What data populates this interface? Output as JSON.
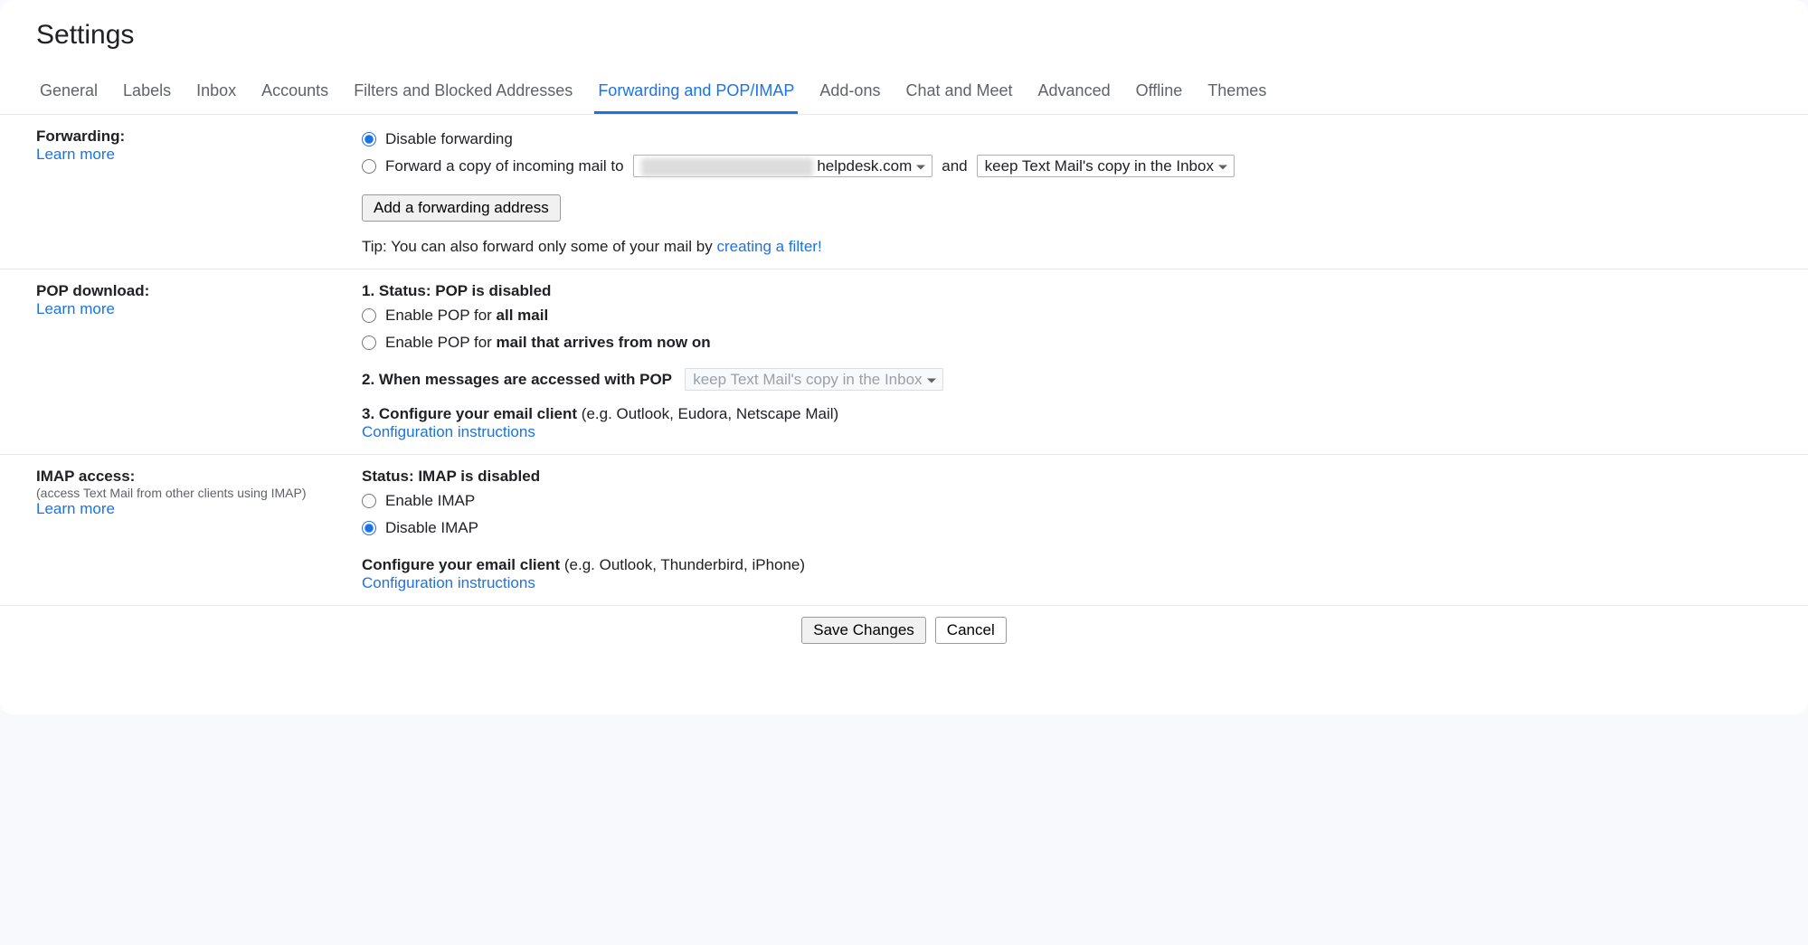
{
  "page_title": "Settings",
  "tabs": [
    {
      "label": "General"
    },
    {
      "label": "Labels"
    },
    {
      "label": "Inbox"
    },
    {
      "label": "Accounts"
    },
    {
      "label": "Filters and Blocked Addresses"
    },
    {
      "label": "Forwarding and POP/IMAP",
      "active": true
    },
    {
      "label": "Add-ons"
    },
    {
      "label": "Chat and Meet"
    },
    {
      "label": "Advanced"
    },
    {
      "label": "Offline"
    },
    {
      "label": "Themes"
    }
  ],
  "learn_more": "Learn more",
  "forwarding": {
    "label": "Forwarding:",
    "opt_disable": "Disable forwarding",
    "opt_forward_prefix": "Forward a copy of incoming mail to",
    "address_suffix": "helpdesk.com",
    "and_text": "and",
    "keep_option": "keep Text Mail's copy in the Inbox",
    "add_button": "Add a forwarding address",
    "tip_prefix": "Tip: You can also forward only some of your mail by ",
    "tip_link": "creating a filter!"
  },
  "pop": {
    "label": "POP download:",
    "status_prefix": "1. ",
    "status_label": "Status: POP is disabled",
    "enable_prefix": "Enable POP for ",
    "enable_all_bold": "all mail",
    "enable_new_bold": "mail that arrives from now on",
    "when_prefix": "2. ",
    "when_label": "When messages are accessed with POP",
    "when_select": "keep Text Mail's copy in the Inbox",
    "configure_prefix": "3. ",
    "configure_label": "Configure your email client",
    "configure_hint": " (e.g. Outlook, Eudora, Netscape Mail)",
    "config_link": "Configuration instructions"
  },
  "imap": {
    "label": "IMAP access:",
    "sub": "(access Text Mail from other clients using IMAP)",
    "status_label": "Status: IMAP is disabled",
    "enable": "Enable IMAP",
    "disable": "Disable IMAP",
    "configure_label": "Configure your email client",
    "configure_hint": " (e.g. Outlook, Thunderbird, iPhone)",
    "config_link": "Configuration instructions"
  },
  "buttons": {
    "save": "Save Changes",
    "cancel": "Cancel"
  }
}
